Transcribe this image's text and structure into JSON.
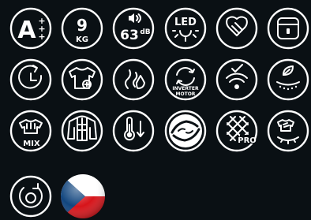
{
  "badges": {
    "energy": {
      "letter": "A",
      "pluses": [
        "+",
        "+",
        "+"
      ],
      "icon": "energy-class-icon"
    },
    "load": {
      "value": "9",
      "unit": "KG",
      "icon": "load-capacity-icon"
    },
    "noise": {
      "value": "63",
      "unit": "dB",
      "icon": "noise-level-icon"
    },
    "led": {
      "label": "LED",
      "icon": "led-display-icon"
    },
    "care": {
      "icon": "gentle-care-hands-icon"
    },
    "door": {
      "icon": "door-lock-icon"
    },
    "timer": {
      "icon": "delay-timer-icon"
    },
    "anti_allergy": {
      "icon": "anti-allergy-shirt-icon"
    },
    "steam": {
      "icon": "steam-refresh-icon"
    },
    "inverter": {
      "line1": "INVERTER",
      "line2": "MOTOR",
      "icon": "inverter-motor-icon"
    },
    "wifi": {
      "icon": "wifi-connect-icon"
    },
    "eco_drum": {
      "icon": "eco-drum-icon"
    },
    "mix": {
      "label": "MIX",
      "icon": "mixed-load-icon"
    },
    "jacket": {
      "icon": "outdoor-jacket-icon"
    },
    "cold_wash": {
      "icon": "temperature-down-icon"
    },
    "hygiene": {
      "icon": "hygiene-care-icon"
    },
    "drum_pro": {
      "label": "PRO",
      "icon": "pro-drum-icon"
    },
    "quick": {
      "icon": "quick-wash-icon"
    },
    "self_clean": {
      "icon": "self-clean-icon"
    },
    "flag": {
      "icon": "czech-flag-icon"
    }
  },
  "colors": {
    "background": "#0a1014",
    "icon": "#ffffff",
    "flag_white": "#ffffff",
    "flag_red": "#d7141a",
    "flag_blue": "#11457e"
  }
}
